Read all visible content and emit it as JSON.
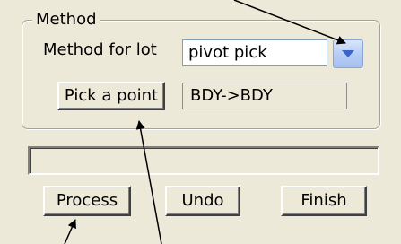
{
  "method_group": {
    "legend": "Method",
    "method_label": "Method for lot",
    "method_value": "pivot pick",
    "pick_button": "Pick a point",
    "pick_result": "BDY->BDY"
  },
  "status_bar": {
    "text": ""
  },
  "buttons": {
    "process": "Process",
    "undo": "Undo",
    "finish": "Finish"
  },
  "icons": {
    "dropdown": "chevron-down-icon"
  },
  "colors": {
    "background": "#ece9d8",
    "arrow": "#000000",
    "dropdown_accent": "#3a64c8"
  }
}
